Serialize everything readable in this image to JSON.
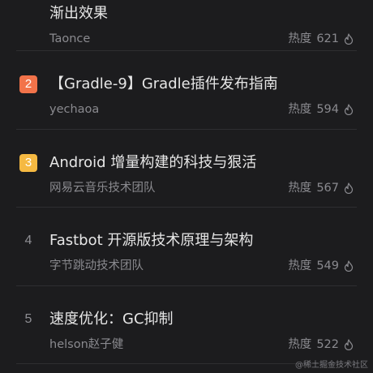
{
  "colors": {
    "background": "#1c1c1e",
    "rank2_badge": "#f2734a",
    "rank3_badge": "#f5b942",
    "title_text": "#e6e6e6",
    "meta_text": "#8a8a8f"
  },
  "heat_label": "热度",
  "icons": {
    "heat": "flame-icon"
  },
  "articles": [
    {
      "rank": "",
      "title": "渐出效果",
      "author": "Taonce",
      "heat": "621"
    },
    {
      "rank": "2",
      "title": "【Gradle-9】Gradle插件发布指南",
      "author": "yechaoa",
      "heat": "594"
    },
    {
      "rank": "3",
      "title": "Android 增量构建的科技与狠活",
      "author": "网易云音乐技术团队",
      "heat": "567"
    },
    {
      "rank": "4",
      "title": "Fastbot 开源版技术原理与架构",
      "author": "字节跳动技术团队",
      "heat": "549"
    },
    {
      "rank": "5",
      "title": "速度优化：GC抑制",
      "author": "helson赵子健",
      "heat": "522"
    }
  ],
  "watermark": "@稀土掘金技术社区"
}
